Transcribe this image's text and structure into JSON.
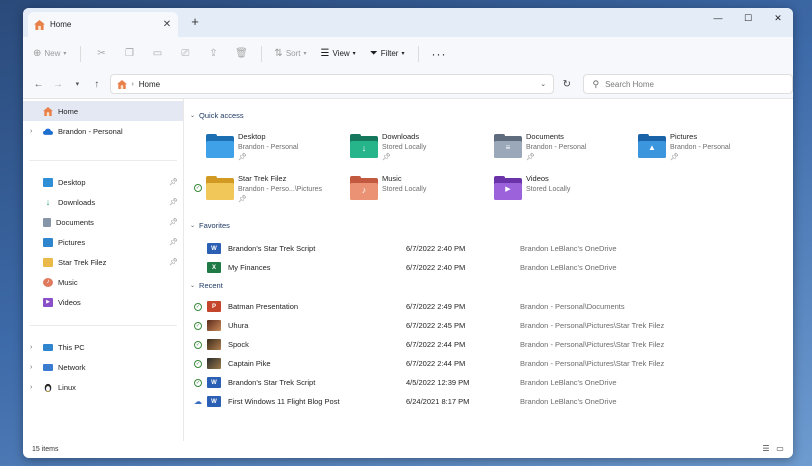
{
  "window": {
    "tab_title": "Home",
    "new_tab": "+",
    "tab_close": "✕",
    "minimize": "—",
    "maximize": "☐",
    "close": "✕"
  },
  "toolbar": {
    "new_label": "New",
    "sort_label": "Sort",
    "view_label": "View",
    "filter_label": "Filter",
    "more": "···"
  },
  "address": {
    "path": "Home",
    "search_placeholder": "Search Home"
  },
  "sidebar": {
    "top": [
      {
        "label": "Home",
        "icon": "home-icon",
        "selected": true
      },
      {
        "label": "Brandon - Personal",
        "icon": "onedrive-cloud-icon",
        "expandable": true
      }
    ],
    "pinned": [
      {
        "label": "Desktop",
        "icon": "desktop-icon"
      },
      {
        "label": "Downloads",
        "icon": "download-icon"
      },
      {
        "label": "Documents",
        "icon": "documents-icon"
      },
      {
        "label": "Pictures",
        "icon": "pictures-icon"
      },
      {
        "label": "Star Trek Filez",
        "icon": "folder-icon"
      },
      {
        "label": "Music",
        "icon": "music-icon"
      },
      {
        "label": "Videos",
        "icon": "videos-icon"
      }
    ],
    "bottom": [
      {
        "label": "This PC",
        "icon": "this-pc-icon"
      },
      {
        "label": "Network",
        "icon": "network-icon"
      },
      {
        "label": "Linux",
        "icon": "linux-penguin-icon"
      }
    ]
  },
  "quick_access": {
    "title": "Quick access",
    "items": [
      {
        "name": "Desktop",
        "sub": "Brandon - Personal",
        "color": "#2e8fd6"
      },
      {
        "name": "Downloads",
        "sub": "Stored Locally",
        "color": "#1f9e7a"
      },
      {
        "name": "Documents",
        "sub": "Brandon - Personal",
        "color": "#8795a8"
      },
      {
        "name": "Pictures",
        "sub": "Brandon - Personal",
        "color": "#2f86cf"
      },
      {
        "name": "Star Trek Filez",
        "sub": "Brandon - Perso...\\Pictures",
        "color": "#e9b949"
      },
      {
        "name": "Music",
        "sub": "Stored Locally",
        "color": "#e07a5f"
      },
      {
        "name": "Videos",
        "sub": "Stored Locally",
        "color": "#8a4fc9"
      }
    ]
  },
  "favorites": {
    "title": "Favorites",
    "rows": [
      {
        "name": "Brandon's Star Trek Script",
        "date": "6/7/2022 2:40 PM",
        "location": "Brandon LeBlanc's OneDrive",
        "type": "word"
      },
      {
        "name": "My Finances",
        "date": "6/7/2022 2:40 PM",
        "location": "Brandon LeBlanc's OneDrive",
        "type": "excel"
      }
    ]
  },
  "recent": {
    "title": "Recent",
    "rows": [
      {
        "name": "Batman Presentation",
        "date": "6/7/2022 2:49 PM",
        "location": "Brandon - Personal\\Documents",
        "type": "ppt",
        "status": "ok"
      },
      {
        "name": "Uhura",
        "date": "6/7/2022 2:45 PM",
        "location": "Brandon - Personal\\Pictures\\Star Trek Filez",
        "type": "image",
        "status": "ok"
      },
      {
        "name": "Spock",
        "date": "6/7/2022 2:44 PM",
        "location": "Brandon - Personal\\Pictures\\Star Trek Filez",
        "type": "image",
        "status": "ok"
      },
      {
        "name": "Captain Pike",
        "date": "6/7/2022 2:44 PM",
        "location": "Brandon - Personal\\Pictures\\Star Trek Filez",
        "type": "image",
        "status": "ok"
      },
      {
        "name": "Brandon's Star Trek Script",
        "date": "4/5/2022 12:39 PM",
        "location": "Brandon LeBlanc's OneDrive",
        "type": "word",
        "status": "ok"
      },
      {
        "name": "First Windows 11 Flight Blog Post",
        "date": "6/24/2021 8:17 PM",
        "location": "Brandon LeBlanc's OneDrive",
        "type": "word",
        "status": "cloud"
      }
    ]
  },
  "statusbar": {
    "count": "15 items"
  }
}
